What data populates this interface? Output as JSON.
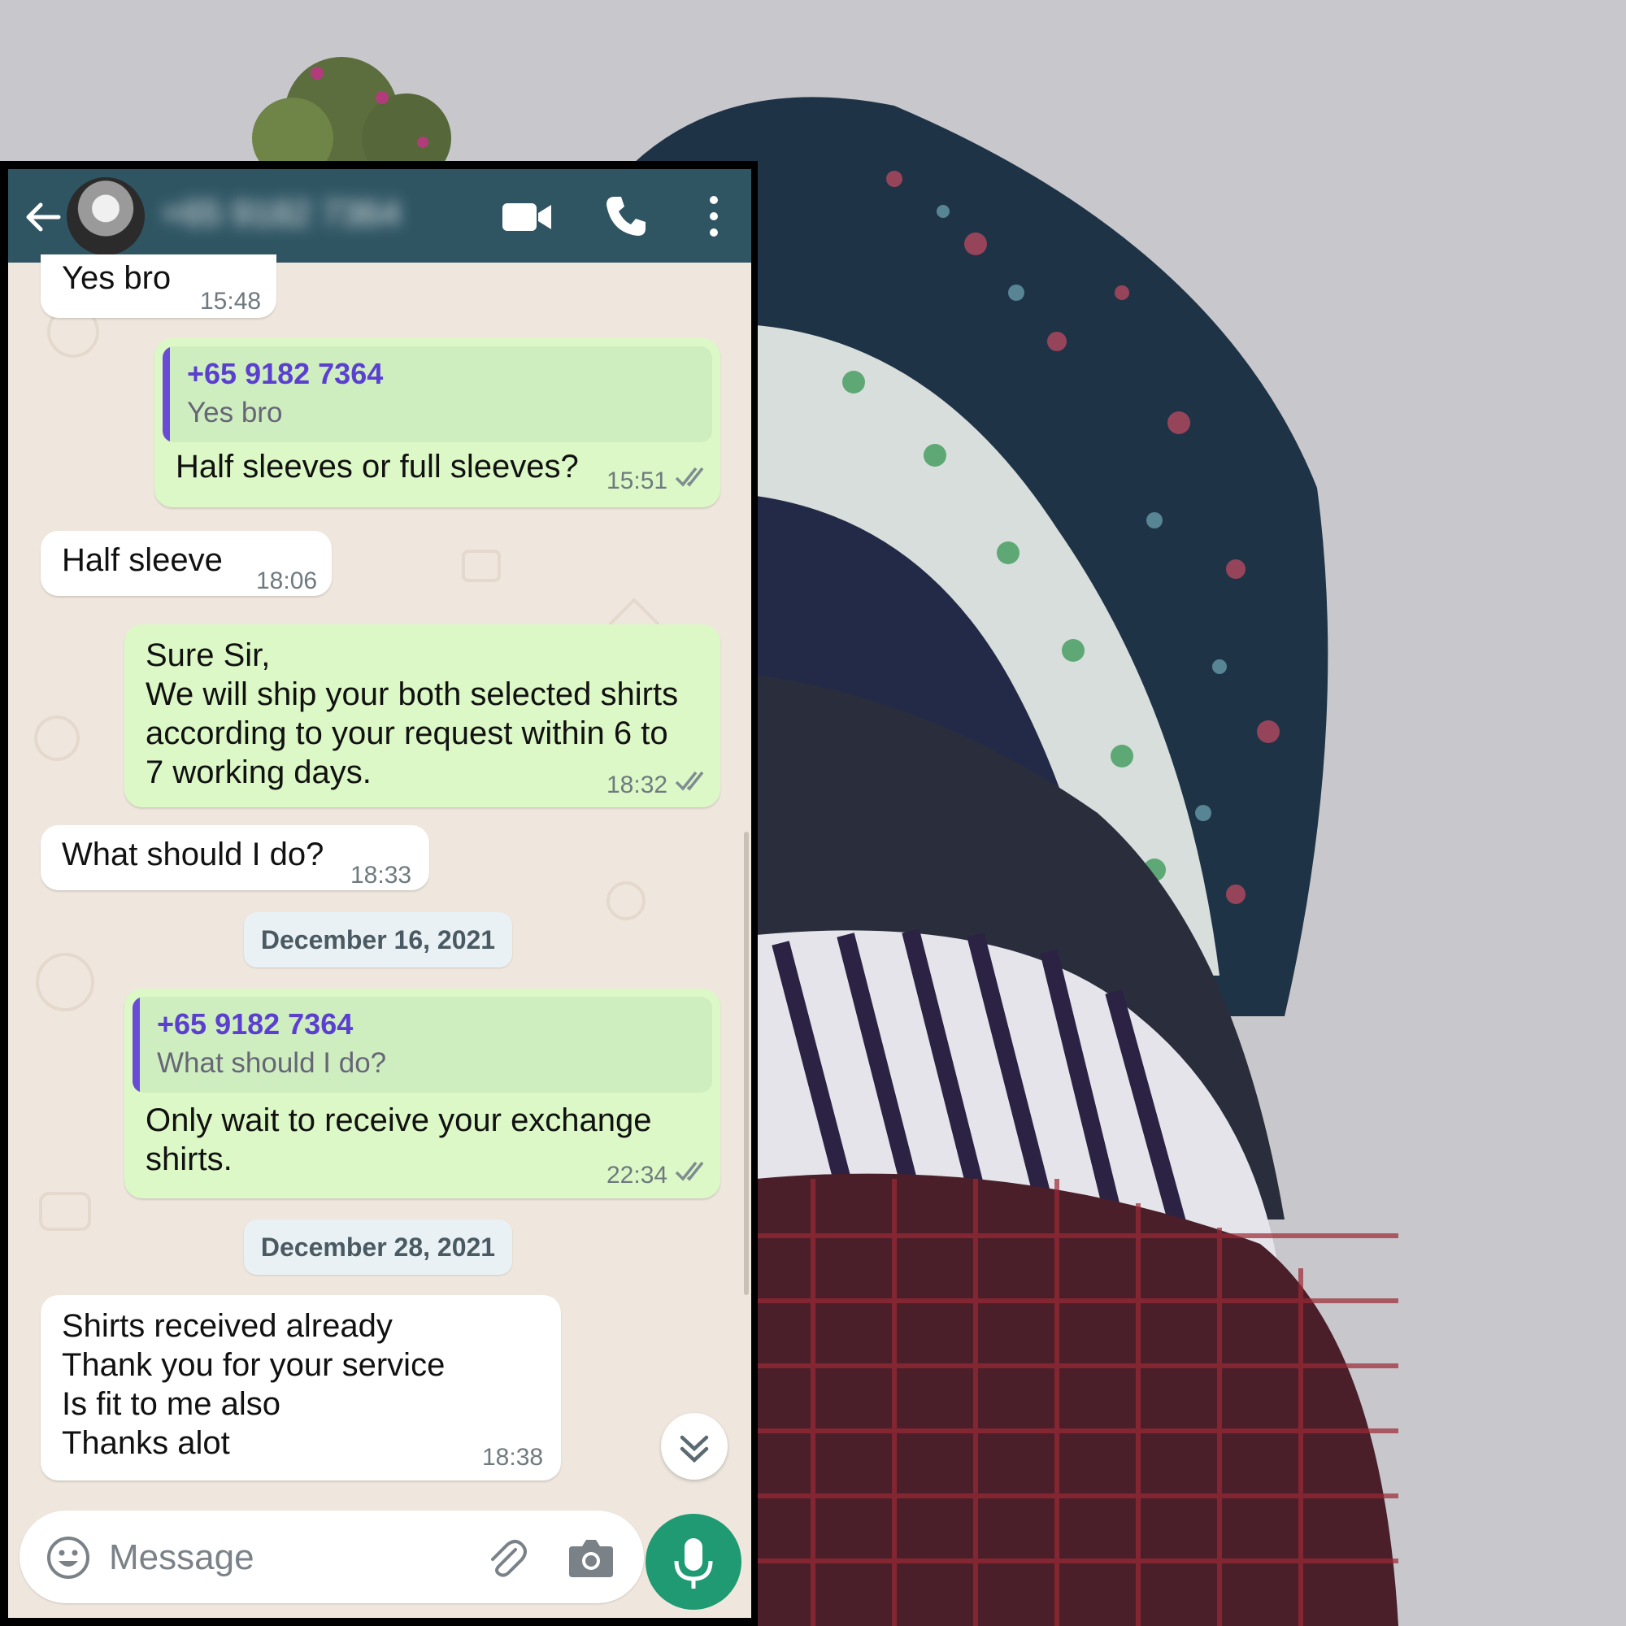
{
  "header": {
    "contact_name": "+65 9182 7364"
  },
  "messages": [
    {
      "dir": "in",
      "text": "Yes bro",
      "time": "15:48"
    },
    {
      "dir": "out",
      "quote_name": "+65 9182 7364",
      "quote_text": "Yes bro",
      "text": "Half sleeves or full sleeves?",
      "time": "15:51"
    },
    {
      "dir": "in",
      "text": "Half sleeve",
      "time": "18:06"
    },
    {
      "dir": "out",
      "text": "Sure Sir,\nWe will ship your both selected shirts\naccording to your request within 6 to\n7 working days.",
      "time": "18:32"
    },
    {
      "dir": "in",
      "text": "What should I do?",
      "time": "18:33"
    },
    {
      "dir": "out",
      "quote_name": "+65 9182 7364",
      "quote_text": "What should I do?",
      "text": "Only wait to receive your exchange\nshirts.",
      "time": "22:34"
    },
    {
      "dir": "in",
      "text": "Shirts received already\nThank you for your service\nIs fit to me also\nThanks alot",
      "time": "18:38"
    }
  ],
  "date_chips": [
    "December 16, 2021",
    "December 28, 2021"
  ],
  "input": {
    "placeholder": "Message"
  },
  "icons": {
    "back": "arrow-left-icon",
    "video": "video-camera-icon",
    "call": "phone-icon",
    "menu": "more-vertical-icon",
    "emoji": "emoji-icon",
    "attach": "paperclip-icon",
    "camera": "camera-icon",
    "mic": "microphone-icon",
    "scroll": "double-chevron-down-icon",
    "read": "double-check-icon"
  },
  "colors": {
    "header": "#2f5563",
    "outgoing_bubble": "#dcf8c6",
    "incoming_bubble": "#ffffff",
    "chat_background": "#efe7dd",
    "quote_accent": "#6a4bd6",
    "mic_button": "#1f9a72"
  }
}
